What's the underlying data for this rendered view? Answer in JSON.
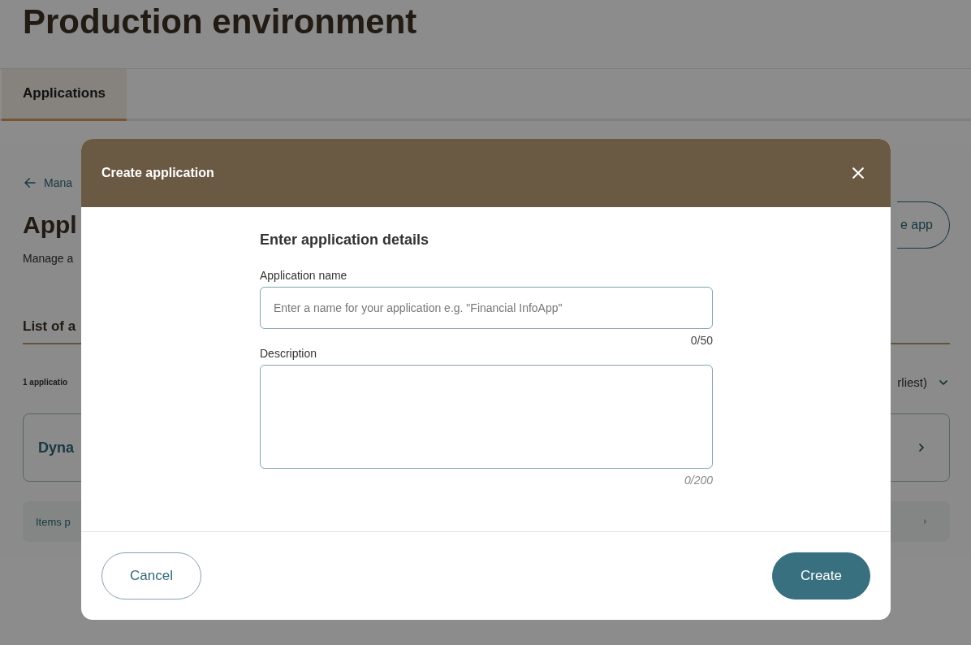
{
  "page": {
    "title": "Production environment",
    "tabs": [
      {
        "label": "Applications",
        "selected": true
      }
    ]
  },
  "background": {
    "back_link": "Mana",
    "heading": "Appl",
    "create_button": "e app",
    "subtitle": "Manage a",
    "list_heading": "List of a",
    "count": "1 applicatio",
    "sort": "rliest)",
    "rows": [
      {
        "name": "Dyna"
      }
    ],
    "pagination": {
      "label": "Items p"
    }
  },
  "dialog": {
    "title": "Create application",
    "section_title": "Enter application details",
    "fields": [
      {
        "kind": "input",
        "label": "Application name",
        "placeholder": "Enter a name for your application e.g. \"Financial InfoApp\"",
        "counter": "0/50"
      },
      {
        "kind": "textarea",
        "label": "Description",
        "counter": "0/200"
      }
    ],
    "buttons": [
      {
        "kind": "secondary",
        "label": "Cancel"
      },
      {
        "kind": "primary",
        "label": "Create"
      }
    ]
  }
}
